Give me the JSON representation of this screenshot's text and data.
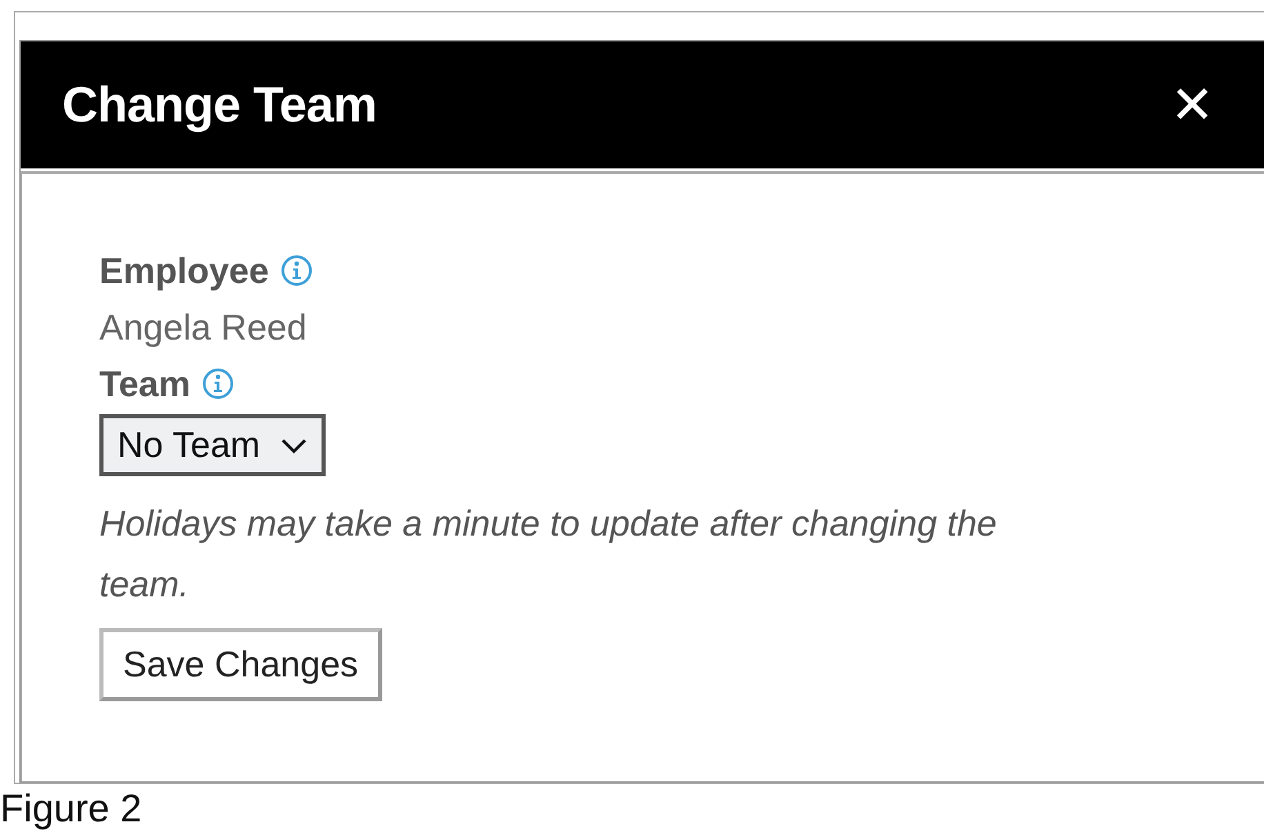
{
  "dialog": {
    "title": "Change Team",
    "close": "✕"
  },
  "fields": [
    {
      "kind": "text",
      "label": "Employee",
      "value": "Angela Reed"
    },
    {
      "kind": "select",
      "label": "Team",
      "value": "No Team"
    }
  ],
  "note": "Holidays may take a minute to update after changing the team.",
  "buttons": [
    "Save Changes"
  ],
  "caption": "Figure 2"
}
